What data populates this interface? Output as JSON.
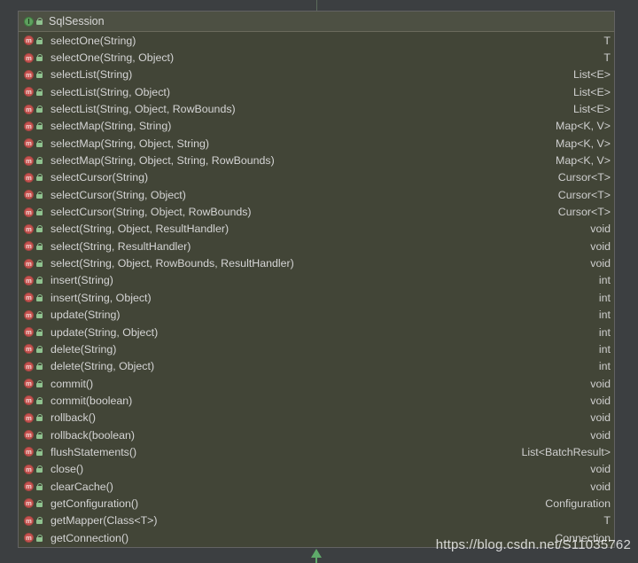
{
  "interface": {
    "icon_letter": "I",
    "title": "SqlSession"
  },
  "method_icon_letter": "m",
  "methods": [
    {
      "signature": "selectOne(String)",
      "returns": "T"
    },
    {
      "signature": "selectOne(String, Object)",
      "returns": "T"
    },
    {
      "signature": "selectList(String)",
      "returns": "List<E>"
    },
    {
      "signature": "selectList(String, Object)",
      "returns": "List<E>"
    },
    {
      "signature": "selectList(String, Object, RowBounds)",
      "returns": "List<E>"
    },
    {
      "signature": "selectMap(String, String)",
      "returns": "Map<K, V>"
    },
    {
      "signature": "selectMap(String, Object, String)",
      "returns": "Map<K, V>"
    },
    {
      "signature": "selectMap(String, Object, String, RowBounds)",
      "returns": "Map<K, V>"
    },
    {
      "signature": "selectCursor(String)",
      "returns": "Cursor<T>"
    },
    {
      "signature": "selectCursor(String, Object)",
      "returns": "Cursor<T>"
    },
    {
      "signature": "selectCursor(String, Object, RowBounds)",
      "returns": "Cursor<T>"
    },
    {
      "signature": "select(String, Object, ResultHandler)",
      "returns": "void"
    },
    {
      "signature": "select(String, ResultHandler)",
      "returns": "void"
    },
    {
      "signature": "select(String, Object, RowBounds, ResultHandler)",
      "returns": "void"
    },
    {
      "signature": "insert(String)",
      "returns": "int"
    },
    {
      "signature": "insert(String, Object)",
      "returns": "int"
    },
    {
      "signature": "update(String)",
      "returns": "int"
    },
    {
      "signature": "update(String, Object)",
      "returns": "int"
    },
    {
      "signature": "delete(String)",
      "returns": "int"
    },
    {
      "signature": "delete(String, Object)",
      "returns": "int"
    },
    {
      "signature": "commit()",
      "returns": "void"
    },
    {
      "signature": "commit(boolean)",
      "returns": "void"
    },
    {
      "signature": "rollback()",
      "returns": "void"
    },
    {
      "signature": "rollback(boolean)",
      "returns": "void"
    },
    {
      "signature": "flushStatements()",
      "returns": "List<BatchResult>"
    },
    {
      "signature": "close()",
      "returns": "void"
    },
    {
      "signature": "clearCache()",
      "returns": "void"
    },
    {
      "signature": "getConfiguration()",
      "returns": "Configuration"
    },
    {
      "signature": "getMapper(Class<T>)",
      "returns": "T"
    },
    {
      "signature": "getConnection()",
      "returns": "Connection"
    }
  ],
  "watermark": "https://blog.csdn.net/S11035762",
  "colors": {
    "background": "#3c3f41",
    "panel": "#424537",
    "method_icon": "#c75450",
    "interface_icon": "#5fa05f",
    "arrow": "#5faa6a"
  }
}
